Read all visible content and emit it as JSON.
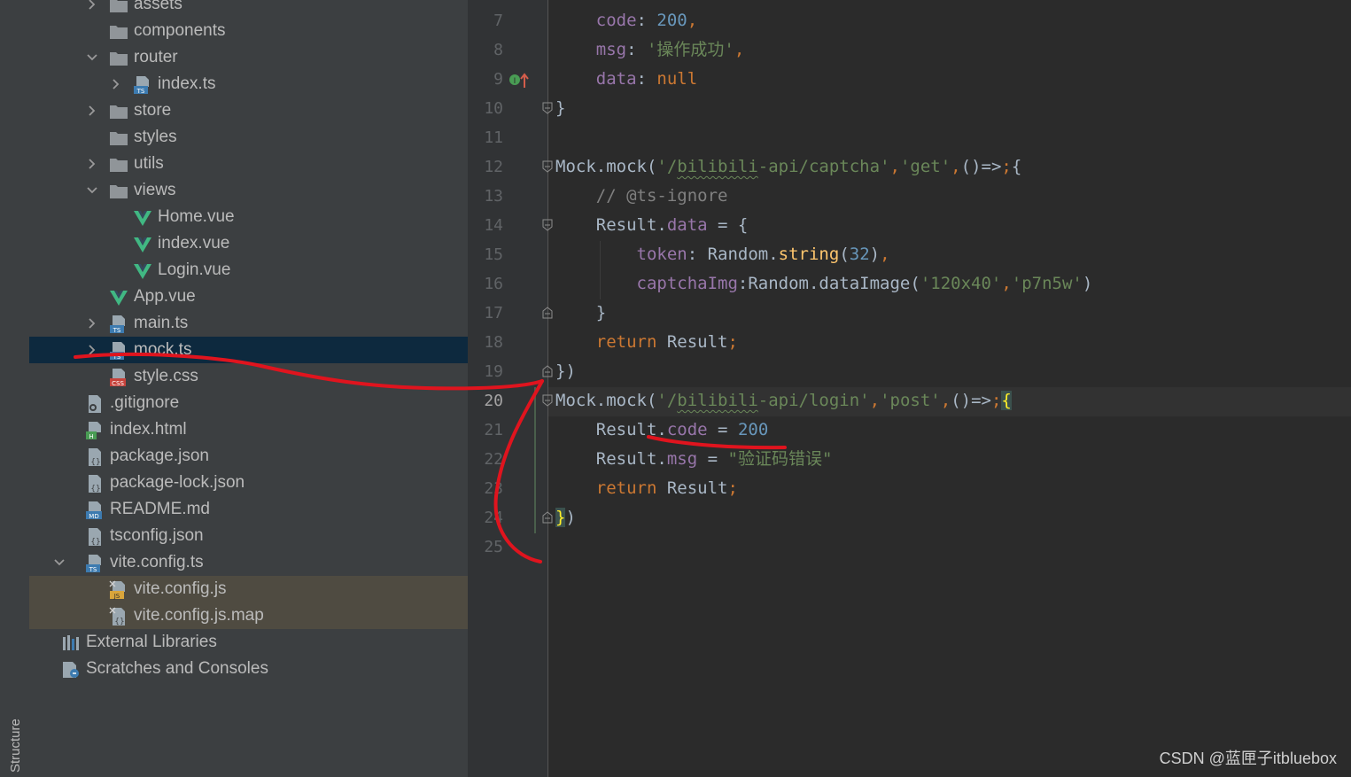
{
  "tool_strip": {
    "structure_label": "Structure"
  },
  "project_tree": {
    "items": [
      {
        "label": "assets",
        "icon": "folder-icon",
        "chevron": "collapsed"
      },
      {
        "label": "components",
        "icon": "folder-icon",
        "chevron": ""
      },
      {
        "label": "router",
        "icon": "folder-icon",
        "chevron": "expanded"
      },
      {
        "label": "index.ts",
        "icon": "typescript-file-icon",
        "chevron": "collapsed"
      },
      {
        "label": "store",
        "icon": "folder-icon",
        "chevron": "collapsed"
      },
      {
        "label": "styles",
        "icon": "folder-icon",
        "chevron": ""
      },
      {
        "label": "utils",
        "icon": "folder-icon",
        "chevron": "collapsed"
      },
      {
        "label": "views",
        "icon": "folder-icon",
        "chevron": "expanded"
      },
      {
        "label": "Home.vue",
        "icon": "vue-file-icon",
        "chevron": ""
      },
      {
        "label": "index.vue",
        "icon": "vue-file-icon",
        "chevron": ""
      },
      {
        "label": "Login.vue",
        "icon": "vue-file-icon",
        "chevron": ""
      },
      {
        "label": "App.vue",
        "icon": "vue-file-icon",
        "chevron": ""
      },
      {
        "label": "main.ts",
        "icon": "typescript-file-icon",
        "chevron": "collapsed"
      },
      {
        "label": "mock.ts",
        "icon": "typescript-file-icon",
        "chevron": "collapsed",
        "selected": true
      },
      {
        "label": "style.css",
        "icon": "css-file-icon",
        "chevron": ""
      },
      {
        "label": ".gitignore",
        "icon": "gitignore-file-icon",
        "chevron": ""
      },
      {
        "label": "index.html",
        "icon": "html-file-icon",
        "chevron": ""
      },
      {
        "label": "package.json",
        "icon": "json-file-icon",
        "chevron": ""
      },
      {
        "label": "package-lock.json",
        "icon": "json-file-icon",
        "chevron": ""
      },
      {
        "label": "README.md",
        "icon": "markdown-file-icon",
        "chevron": ""
      },
      {
        "label": "tsconfig.json",
        "icon": "json-file-icon",
        "chevron": ""
      },
      {
        "label": "vite.config.ts",
        "icon": "typescript-file-icon",
        "chevron": "expanded"
      },
      {
        "label": "vite.config.js",
        "icon": "javascript-file-icon",
        "chevron": "",
        "excluded": true
      },
      {
        "label": "vite.config.js.map",
        "icon": "map-file-icon",
        "chevron": "",
        "excluded": true
      },
      {
        "label": "External Libraries",
        "icon": "library-icon",
        "chevron": ""
      },
      {
        "label": "Scratches and Consoles",
        "icon": "scratches-icon",
        "chevron": ""
      }
    ]
  },
  "editor": {
    "current_line": 20,
    "lines": [
      {
        "number": "7",
        "text": "    code: 200,"
      },
      {
        "number": "8",
        "text": "    msg: '操作成功',"
      },
      {
        "number": "9",
        "text": "    data: null"
      },
      {
        "number": "10",
        "text": "}"
      },
      {
        "number": "11",
        "text": ""
      },
      {
        "number": "12",
        "text": "Mock.mock('/bilibili-api/captcha','get',()=>{"
      },
      {
        "number": "13",
        "text": "    // @ts-ignore"
      },
      {
        "number": "14",
        "text": "    Result.data = {"
      },
      {
        "number": "15",
        "text": "        token: Random.string(32),"
      },
      {
        "number": "16",
        "text": "        captchaImg:Random.dataImage('120x40','p7n5w')"
      },
      {
        "number": "17",
        "text": "    }"
      },
      {
        "number": "18",
        "text": "    return Result;"
      },
      {
        "number": "19",
        "text": "})"
      },
      {
        "number": "20",
        "text": "Mock.mock('/bilibili-api/login','post',()=>{"
      },
      {
        "number": "21",
        "text": "    Result.code = 200"
      },
      {
        "number": "22",
        "text": "    Result.msg = \"验证码错误\""
      },
      {
        "number": "23",
        "text": "    return Result;"
      },
      {
        "number": "24",
        "text": "})"
      },
      {
        "number": "25",
        "text": ""
      }
    ]
  },
  "watermark": "CSDN @蓝匣子itbluebox",
  "colors": {
    "sidebar_bg": "#3c3f41",
    "editor_bg": "#2b2b2b",
    "selection": "#0d293e",
    "excluded": "#4f4b41",
    "annotation": "#e0141e"
  }
}
